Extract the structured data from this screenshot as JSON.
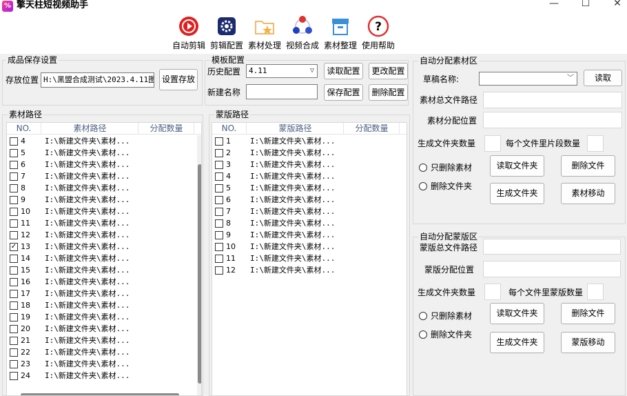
{
  "window": {
    "title": "擎天柱短视频助手",
    "logo_text": "%",
    "minimize": "—",
    "maximize": "☐",
    "close": "✕"
  },
  "toolbar": {
    "items": [
      {
        "label": "自动剪辑",
        "icon": "auto-edit-icon"
      },
      {
        "label": "剪辑配置",
        "icon": "gear-icon"
      },
      {
        "label": "素材处理",
        "icon": "folder-star-icon"
      },
      {
        "label": "视频合成",
        "icon": "merge-icon"
      },
      {
        "label": "素材整理",
        "icon": "box-icon"
      },
      {
        "label": "使用帮助",
        "icon": "help-icon"
      }
    ]
  },
  "save_settings": {
    "title": "成品保存设置",
    "location_label": "存放位置",
    "location_value": "H:\\黑盟合成测试\\2023.4.11图",
    "set_button": "设置存放"
  },
  "template_config": {
    "title": "模板配置",
    "history_label": "历史配置",
    "history_value": "4.11",
    "new_name_label": "新建名称",
    "new_name_value": "",
    "read_button": "读取配置",
    "update_button": "更改配置",
    "save_button": "保存配置",
    "delete_button": "删除配置"
  },
  "material_paths": {
    "title": "素材路径",
    "columns": [
      "NO.",
      "素材路径",
      "分配数量"
    ],
    "rows": [
      {
        "no": "4",
        "path": "I:\\新建文件夹\\素材...",
        "checked": false
      },
      {
        "no": "5",
        "path": "I:\\新建文件夹\\素材...",
        "checked": false
      },
      {
        "no": "6",
        "path": "I:\\新建文件夹\\素材...",
        "checked": false
      },
      {
        "no": "7",
        "path": "I:\\新建文件夹\\素材...",
        "checked": false
      },
      {
        "no": "8",
        "path": "I:\\新建文件夹\\素材...",
        "checked": false
      },
      {
        "no": "9",
        "path": "I:\\新建文件夹\\素材...",
        "checked": false
      },
      {
        "no": "10",
        "path": "I:\\新建文件夹\\素材...",
        "checked": false
      },
      {
        "no": "11",
        "path": "I:\\新建文件夹\\素材...",
        "checked": false
      },
      {
        "no": "12",
        "path": "I:\\新建文件夹\\素材...",
        "checked": false
      },
      {
        "no": "13",
        "path": "I:\\新建文件夹\\素材...",
        "checked": true
      },
      {
        "no": "14",
        "path": "I:\\新建文件夹\\素材...",
        "checked": false
      },
      {
        "no": "15",
        "path": "I:\\新建文件夹\\素材...",
        "checked": false
      },
      {
        "no": "16",
        "path": "I:\\新建文件夹\\素材...",
        "checked": false
      },
      {
        "no": "17",
        "path": "I:\\新建文件夹\\素材...",
        "checked": false
      },
      {
        "no": "18",
        "path": "I:\\新建文件夹\\素材...",
        "checked": false
      },
      {
        "no": "19",
        "path": "I:\\新建文件夹\\素材...",
        "checked": false
      },
      {
        "no": "20",
        "path": "I:\\新建文件夹\\素材...",
        "checked": false
      },
      {
        "no": "21",
        "path": "I:\\新建文件夹\\素材...",
        "checked": false
      },
      {
        "no": "22",
        "path": "I:\\新建文件夹\\素材...",
        "checked": false
      },
      {
        "no": "23",
        "path": "I:\\新建文件夹\\素材...",
        "checked": false
      },
      {
        "no": "24",
        "path": "I:\\新建文件夹\\素材...",
        "checked": false
      }
    ]
  },
  "template_paths": {
    "title": "蒙版路径",
    "columns": [
      "NO.",
      "蒙版路径",
      "分配数量"
    ],
    "rows": [
      {
        "no": "1",
        "path": "I:\\新建文件夹\\素材...",
        "checked": false
      },
      {
        "no": "2",
        "path": "I:\\新建文件夹\\素材...",
        "checked": false
      },
      {
        "no": "3",
        "path": "I:\\新建文件夹\\素材...",
        "checked": false
      },
      {
        "no": "4",
        "path": "I:\\新建文件夹\\素材...",
        "checked": false
      },
      {
        "no": "5",
        "path": "I:\\新建文件夹\\素材...",
        "checked": false
      },
      {
        "no": "6",
        "path": "I:\\新建文件夹\\素材...",
        "checked": false
      },
      {
        "no": "7",
        "path": "I:\\新建文件夹\\素材...",
        "checked": false
      },
      {
        "no": "8",
        "path": "I:\\新建文件夹\\素材...",
        "checked": false
      },
      {
        "no": "9",
        "path": "I:\\新建文件夹\\素材...",
        "checked": false
      },
      {
        "no": "10",
        "path": "I:\\新建文件夹\\素材...",
        "checked": false
      },
      {
        "no": "11",
        "path": "I:\\新建文件夹\\素材...",
        "checked": false
      },
      {
        "no": "12",
        "path": "I:\\新建文件夹\\素材...",
        "checked": false
      }
    ]
  },
  "auto_material": {
    "title": "自动分配素材区",
    "draft_label": "草稿名称:",
    "draft_value": "",
    "read_button": "读取",
    "total_path_label": "素材总文件路径",
    "assign_pos_label": "素材分配位置",
    "gen_count_label": "生成文件夹数量",
    "per_count_label": "每个文件里片段数量",
    "radio_only_delete": "只删除素材",
    "radio_delete_folder": "删除文件夹",
    "read_folder_button": "读取文件夹",
    "delete_file_button": "删除文件",
    "gen_folder_button": "生成文件夹",
    "move_button": "素材移动"
  },
  "auto_template": {
    "title": "自动分配蒙版区",
    "total_path_label": "蒙版总文件路径",
    "assign_pos_label": "蒙版分配位置",
    "gen_count_label": "生成文件夹数量",
    "per_count_label": "每个文件里蒙版数量",
    "radio_only_delete": "只删除素材",
    "radio_delete_folder": "删除文件夹",
    "read_folder_button": "读取文件夹",
    "delete_file_button": "删除文件",
    "gen_folder_button": "生成文件夹",
    "move_button": "蒙版移动"
  }
}
